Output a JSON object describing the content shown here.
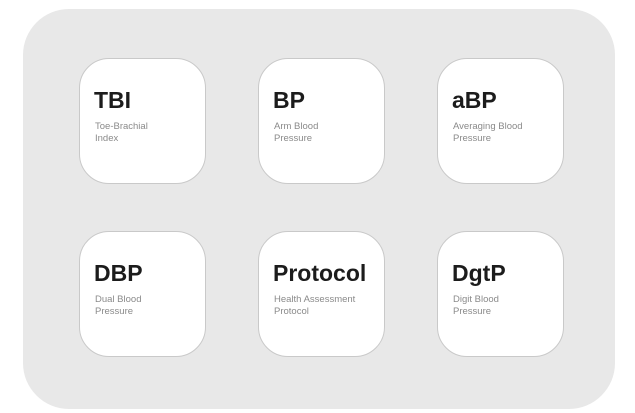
{
  "modes": [
    {
      "code": "TBI",
      "desc_line1": "Toe-Brachial",
      "desc_line2": "Index"
    },
    {
      "code": "BP",
      "desc_line1": "Arm Blood",
      "desc_line2": "Pressure"
    },
    {
      "code": "aBP",
      "desc_line1": "Averaging Blood",
      "desc_line2": "Pressure"
    },
    {
      "code": "DBP",
      "desc_line1": "Dual Blood",
      "desc_line2": "Pressure"
    },
    {
      "code": "Protocol",
      "desc_line1": "Health Assessment",
      "desc_line2": "Protocol"
    },
    {
      "code": "DgtP",
      "desc_line1": "Digit Blood",
      "desc_line2": "Pressure"
    }
  ]
}
